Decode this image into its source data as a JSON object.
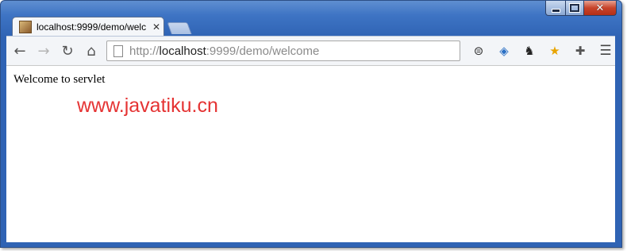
{
  "tab": {
    "title": "localhost:9999/demo/welc"
  },
  "toolbar": {
    "url_scheme": "http://",
    "url_host": "localhost",
    "url_rest": ":9999/demo/welcome"
  },
  "icons": {
    "back": "←",
    "forward": "→",
    "reload": "↻",
    "home": "⌂",
    "close": "✕",
    "menu": "☰"
  },
  "page": {
    "body_text": "Welcome to servlet",
    "watermark": "www.javatiku.cn"
  },
  "colors": {
    "frame": "#2f63b4",
    "watermark": "#e53333"
  }
}
